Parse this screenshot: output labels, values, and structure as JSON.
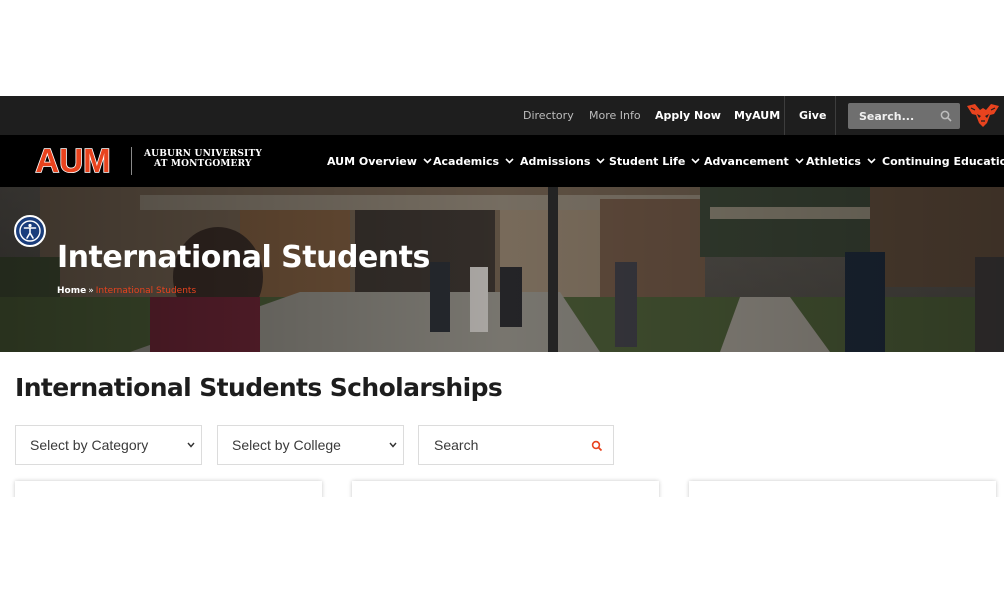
{
  "topbar": {
    "links": {
      "directory": "Directory",
      "more_info": "More Info",
      "apply_now": "Apply Now",
      "myaum": "MyAUM",
      "give": "Give"
    },
    "search_placeholder": "Search..."
  },
  "brand": {
    "logo_text": "AUM",
    "university_line1": "AUBURN UNIVERSITY",
    "university_line2": "AT MONTGOMERY"
  },
  "nav": {
    "items": [
      {
        "label": "AUM Overview"
      },
      {
        "label": "Academics"
      },
      {
        "label": "Admissions"
      },
      {
        "label": "Student Life"
      },
      {
        "label": "Advancement"
      },
      {
        "label": "Athletics"
      },
      {
        "label": "Continuing Education"
      }
    ]
  },
  "hero": {
    "title": "International Students",
    "breadcrumb": {
      "home": "Home",
      "separator": "»",
      "current": "International Students"
    }
  },
  "main": {
    "heading": "International Students Scholarships",
    "filters": {
      "category": "Select by Category",
      "college": "Select by College",
      "search_placeholder": "Search"
    }
  },
  "icons": {
    "topbar_search": "search-icon",
    "tiger": "tiger-logo-icon",
    "accessibility": "accessibility-icon",
    "nav_chevron": "chevron-down-icon",
    "select_caret": "chevron-down-icon",
    "filter_search": "search-icon"
  },
  "colors": {
    "brand_orange": "#e8431e",
    "topbar_bg": "#1e1e1e",
    "nav_bg": "#000000",
    "accessibility_blue": "#1a3d7c",
    "heading": "#1d1d1d"
  }
}
